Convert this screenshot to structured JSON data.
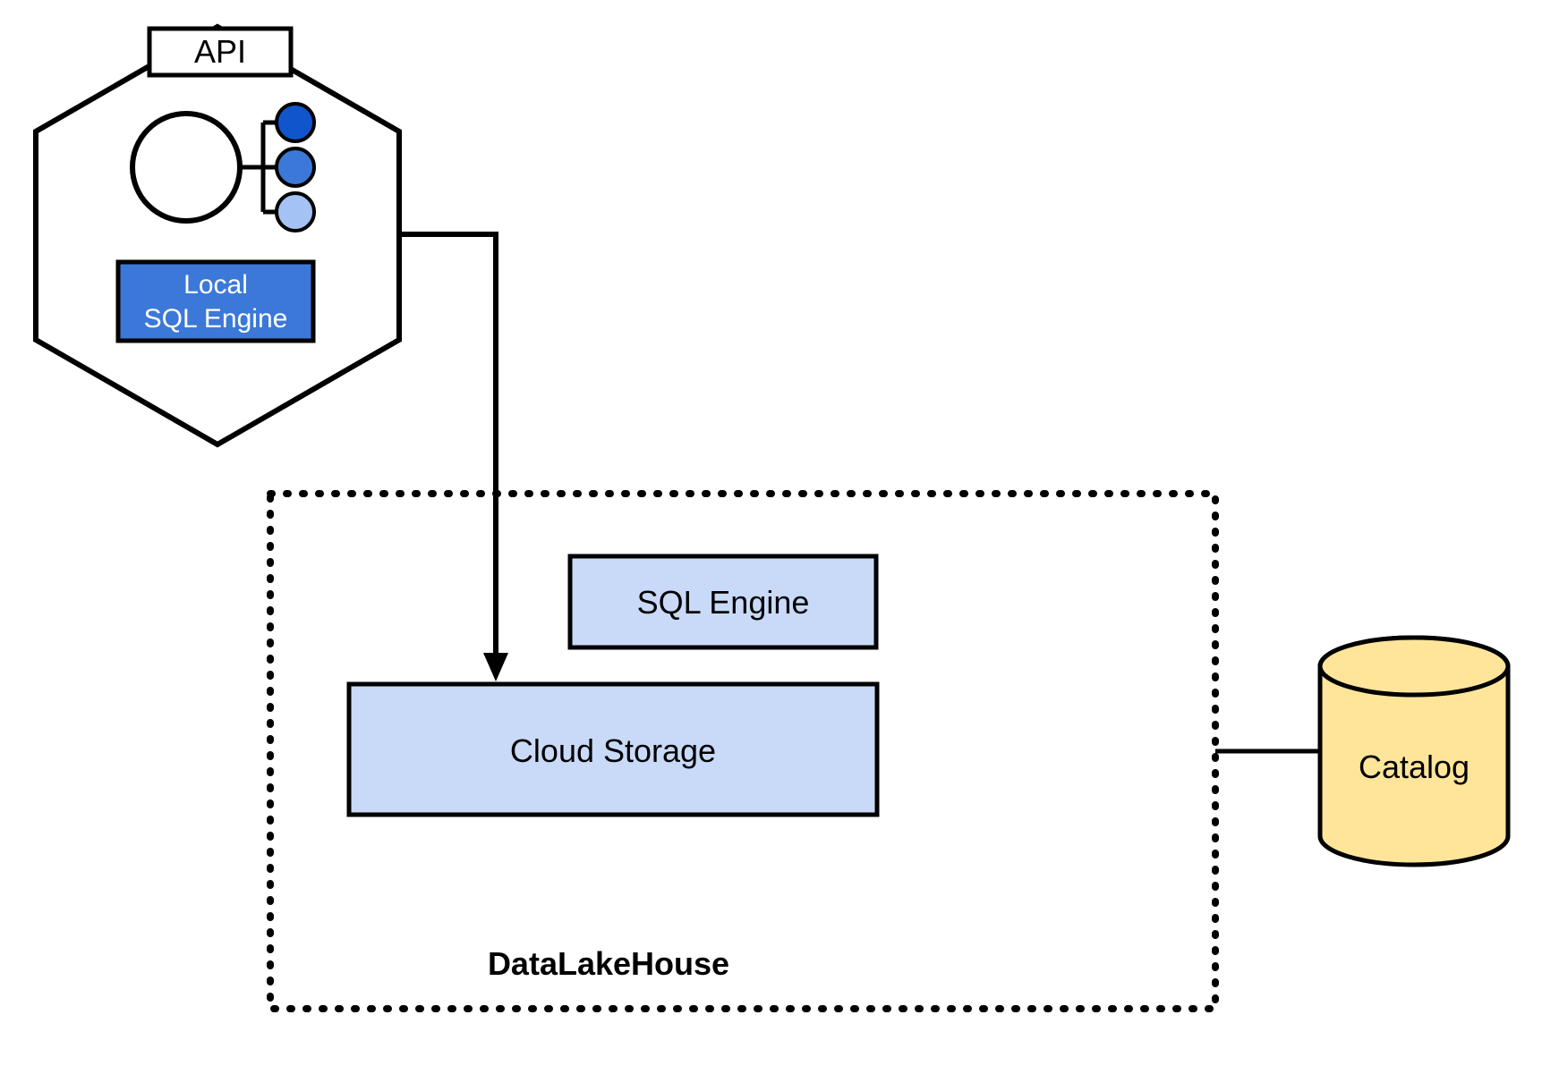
{
  "hexagon": {
    "api_label": "API",
    "local_sql_line1": "Local",
    "local_sql_line2": "SQL Engine"
  },
  "lakehouse": {
    "title": "DataLakeHouse",
    "sql_engine_label": "SQL Engine",
    "cloud_storage_label": "Cloud Storage"
  },
  "catalog": {
    "label": "Catalog"
  },
  "colors": {
    "hex_stroke": "#000000",
    "api_fill": "#ffffff",
    "local_sql_fill": "#3c78d8",
    "local_sql_text": "#ffffff",
    "box_fill": "#c9daf8",
    "box_stroke": "#000000",
    "catalog_fill": "#ffe599",
    "circle_dark": "#1155cc",
    "circle_mid": "#3c78d8",
    "circle_light": "#a4c2f4"
  }
}
